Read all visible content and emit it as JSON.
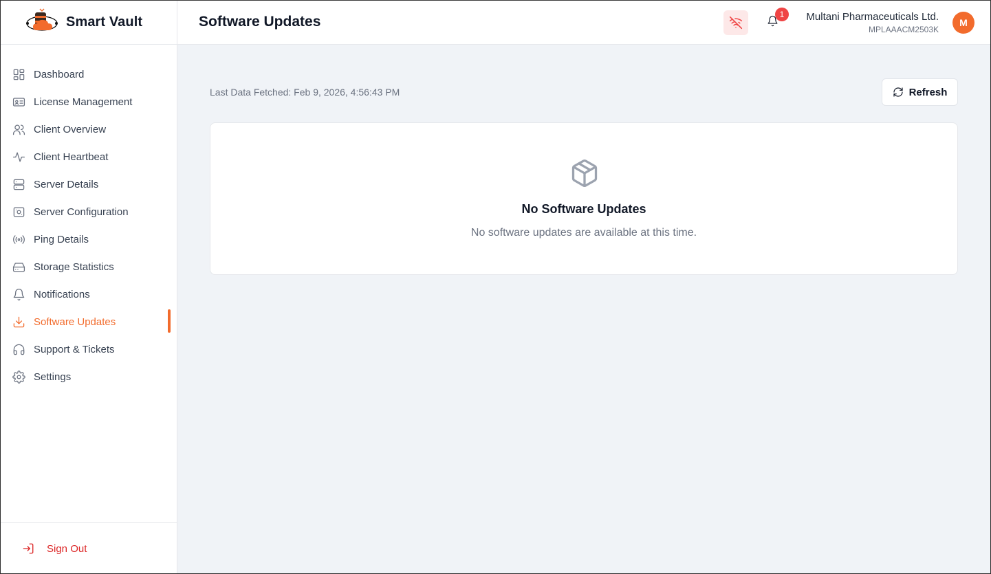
{
  "brand": {
    "name": "Smart Vault",
    "logo_icon": "vault-cloud-logo"
  },
  "sidebar": {
    "items": [
      {
        "label": "Dashboard",
        "icon": "dashboard-grid-icon"
      },
      {
        "label": "License Management",
        "icon": "id-card-icon"
      },
      {
        "label": "Client Overview",
        "icon": "users-icon"
      },
      {
        "label": "Client Heartbeat",
        "icon": "pulse-icon"
      },
      {
        "label": "Server Details",
        "icon": "server-icon"
      },
      {
        "label": "Server Configuration",
        "icon": "server-config-icon"
      },
      {
        "label": "Ping Details",
        "icon": "broadcast-icon"
      },
      {
        "label": "Storage Statistics",
        "icon": "hard-drive-icon"
      },
      {
        "label": "Notifications",
        "icon": "bell-icon"
      },
      {
        "label": "Software Updates",
        "icon": "download-icon",
        "active": true
      },
      {
        "label": "Support & Tickets",
        "icon": "headphones-icon"
      },
      {
        "label": "Settings",
        "icon": "gear-icon"
      }
    ],
    "sign_out": "Sign Out"
  },
  "header": {
    "title": "Software Updates",
    "notification_count": "1",
    "company_name": "Multani Pharmaceuticals Ltd.",
    "company_id": "MPLAAACM2503K",
    "avatar_initial": "M"
  },
  "main": {
    "last_fetched": "Last Data Fetched: Feb 9, 2026, 4:56:43 PM",
    "refresh_label": "Refresh",
    "empty_title": "No Software Updates",
    "empty_subtitle": "No software updates are available at this time."
  },
  "colors": {
    "accent": "#f26b2c",
    "danger": "#dc2626",
    "offline_bg": "#fde8e8"
  }
}
